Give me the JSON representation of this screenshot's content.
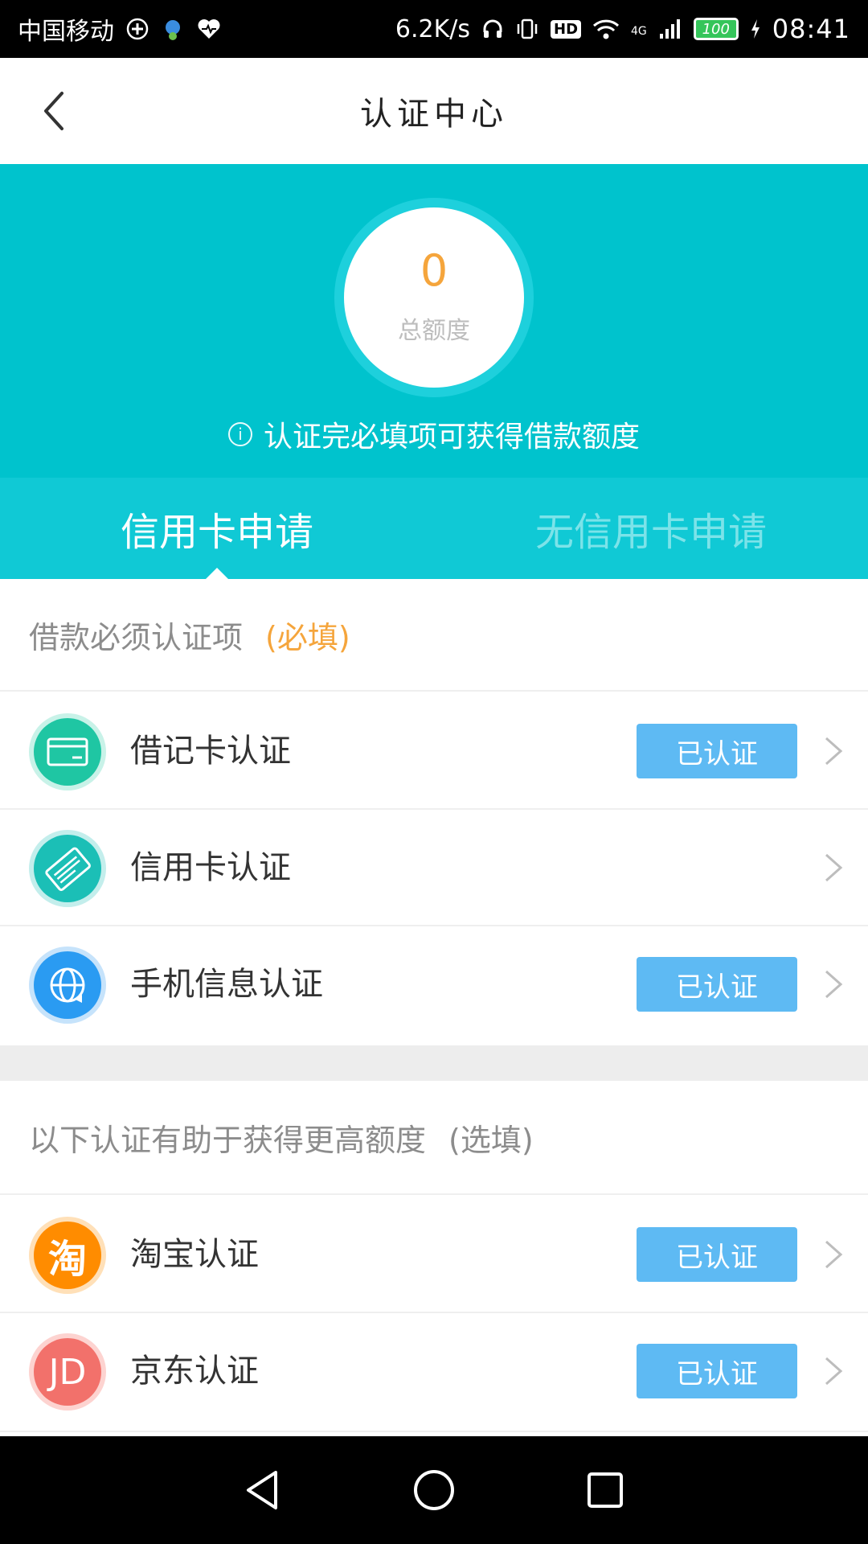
{
  "status_bar": {
    "carrier": "中国移动",
    "speed": "6.2K/s",
    "hd": "HD",
    "network": "4G",
    "battery": "100",
    "time": "08:41"
  },
  "header": {
    "title": "认证中心"
  },
  "hero": {
    "quota_value": "0",
    "quota_label": "总额度",
    "hint": "认证完必填项可获得借款额度",
    "info_glyph": "i"
  },
  "tabs": [
    {
      "label": "信用卡申请",
      "active": true
    },
    {
      "label": "无信用卡申请",
      "active": false
    }
  ],
  "required_section": {
    "title": "借款必须认证项",
    "tag": "(必填)",
    "items": [
      {
        "label": "借记卡认证",
        "status": "已认证",
        "icon": "debit-card-icon",
        "color": "#1fc6a3"
      },
      {
        "label": "信用卡认证",
        "status": "",
        "icon": "credit-card-icon",
        "color": "#1bbfb6"
      },
      {
        "label": "手机信息认证",
        "status": "已认证",
        "icon": "phone-globe-icon",
        "color": "#2a9bf2"
      }
    ]
  },
  "optional_section": {
    "title": "以下认证有助于获得更高额度",
    "tag": "(选填)",
    "items": [
      {
        "label": "淘宝认证",
        "status": "已认证",
        "icon": "taobao-icon",
        "icon_text": "淘",
        "color": "#ff8c00"
      },
      {
        "label": "京东认证",
        "status": "已认证",
        "icon": "jd-icon",
        "icon_text": "JD",
        "color": "#f2716b"
      }
    ]
  },
  "colors": {
    "accent": "#00c3cd",
    "tab_bar": "#10c9d5",
    "badge": "#5ebaf3",
    "highlight": "#f5a53c"
  }
}
